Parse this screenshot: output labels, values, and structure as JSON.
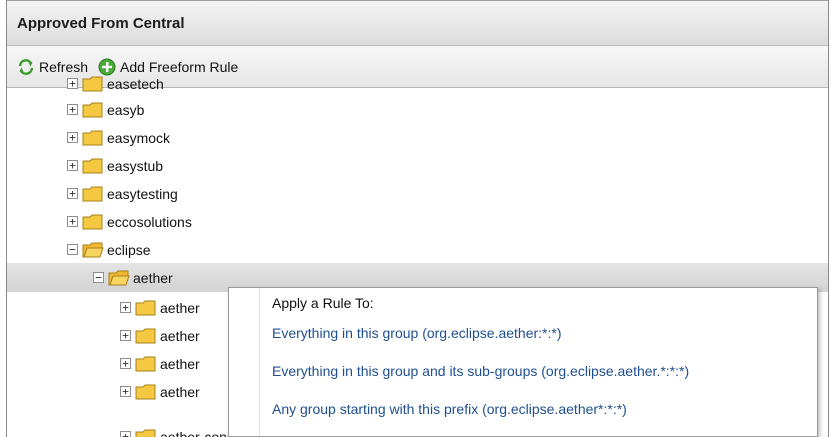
{
  "panel": {
    "title": "Approved From Central"
  },
  "toolbar": {
    "refresh_label": "Refresh",
    "add_rule_label": "Add Freeform Rule"
  },
  "tree": {
    "partial_top_label": "easetech",
    "items": [
      {
        "label": "easyb",
        "expanded": false
      },
      {
        "label": "easymock",
        "expanded": false
      },
      {
        "label": "easystub",
        "expanded": false
      },
      {
        "label": "easytesting",
        "expanded": false
      },
      {
        "label": "eccosolutions",
        "expanded": false
      },
      {
        "label": "eclipse",
        "expanded": true
      },
      {
        "label": "aether",
        "expanded": true,
        "selected": true
      },
      {
        "label": "aether",
        "expanded": false
      },
      {
        "label": "aether",
        "expanded": false
      },
      {
        "label": "aether",
        "expanded": false
      },
      {
        "label": "aether",
        "expanded": false
      }
    ],
    "partial_bottom_label": "aether-connector-wagon"
  },
  "context_menu": {
    "title": "Apply a Rule To:",
    "items": [
      "Everything in this group (org.eclipse.aether:*:*)",
      "Everything in this group and its sub-groups (org.eclipse.aether.*:*:*)",
      "Any group starting with this prefix (org.eclipse.aether*:*:*)"
    ]
  },
  "colors": {
    "menu_link": "#1f4f90",
    "folder": "#f5c842",
    "selected_row": "#d9d9d9"
  },
  "icons": {
    "refresh": "refresh-icon",
    "add": "add-circle-icon",
    "folder": "folder-icon",
    "expand": "expand-plus-icon",
    "collapse": "collapse-minus-icon"
  }
}
